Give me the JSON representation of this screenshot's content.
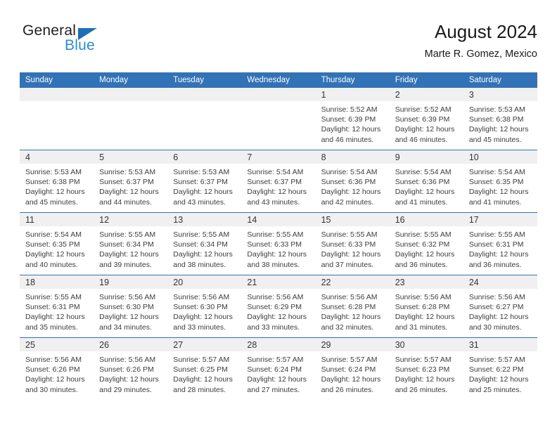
{
  "brand": {
    "name_part1": "General",
    "name_part2": "Blue"
  },
  "header": {
    "title": "August 2024",
    "subtitle": "Marte R. Gomez, Mexico"
  },
  "colors": {
    "header_blue": "#3272b6",
    "brand_blue": "#2b8ccc",
    "logo_triangle": "#1f6fb5",
    "daynum_band": "#f0f0f0",
    "text": "#1a1a1a"
  },
  "weekdays": [
    "Sunday",
    "Monday",
    "Tuesday",
    "Wednesday",
    "Thursday",
    "Friday",
    "Saturday"
  ],
  "weeks": [
    [
      {
        "day": "",
        "sunrise": "",
        "sunset": "",
        "daylight1": "",
        "daylight2": ""
      },
      {
        "day": "",
        "sunrise": "",
        "sunset": "",
        "daylight1": "",
        "daylight2": ""
      },
      {
        "day": "",
        "sunrise": "",
        "sunset": "",
        "daylight1": "",
        "daylight2": ""
      },
      {
        "day": "",
        "sunrise": "",
        "sunset": "",
        "daylight1": "",
        "daylight2": ""
      },
      {
        "day": "1",
        "sunrise": "Sunrise: 5:52 AM",
        "sunset": "Sunset: 6:39 PM",
        "daylight1": "Daylight: 12 hours",
        "daylight2": "and 46 minutes."
      },
      {
        "day": "2",
        "sunrise": "Sunrise: 5:52 AM",
        "sunset": "Sunset: 6:39 PM",
        "daylight1": "Daylight: 12 hours",
        "daylight2": "and 46 minutes."
      },
      {
        "day": "3",
        "sunrise": "Sunrise: 5:53 AM",
        "sunset": "Sunset: 6:38 PM",
        "daylight1": "Daylight: 12 hours",
        "daylight2": "and 45 minutes."
      }
    ],
    [
      {
        "day": "4",
        "sunrise": "Sunrise: 5:53 AM",
        "sunset": "Sunset: 6:38 PM",
        "daylight1": "Daylight: 12 hours",
        "daylight2": "and 45 minutes."
      },
      {
        "day": "5",
        "sunrise": "Sunrise: 5:53 AM",
        "sunset": "Sunset: 6:37 PM",
        "daylight1": "Daylight: 12 hours",
        "daylight2": "and 44 minutes."
      },
      {
        "day": "6",
        "sunrise": "Sunrise: 5:53 AM",
        "sunset": "Sunset: 6:37 PM",
        "daylight1": "Daylight: 12 hours",
        "daylight2": "and 43 minutes."
      },
      {
        "day": "7",
        "sunrise": "Sunrise: 5:54 AM",
        "sunset": "Sunset: 6:37 PM",
        "daylight1": "Daylight: 12 hours",
        "daylight2": "and 43 minutes."
      },
      {
        "day": "8",
        "sunrise": "Sunrise: 5:54 AM",
        "sunset": "Sunset: 6:36 PM",
        "daylight1": "Daylight: 12 hours",
        "daylight2": "and 42 minutes."
      },
      {
        "day": "9",
        "sunrise": "Sunrise: 5:54 AM",
        "sunset": "Sunset: 6:36 PM",
        "daylight1": "Daylight: 12 hours",
        "daylight2": "and 41 minutes."
      },
      {
        "day": "10",
        "sunrise": "Sunrise: 5:54 AM",
        "sunset": "Sunset: 6:35 PM",
        "daylight1": "Daylight: 12 hours",
        "daylight2": "and 41 minutes."
      }
    ],
    [
      {
        "day": "11",
        "sunrise": "Sunrise: 5:54 AM",
        "sunset": "Sunset: 6:35 PM",
        "daylight1": "Daylight: 12 hours",
        "daylight2": "and 40 minutes."
      },
      {
        "day": "12",
        "sunrise": "Sunrise: 5:55 AM",
        "sunset": "Sunset: 6:34 PM",
        "daylight1": "Daylight: 12 hours",
        "daylight2": "and 39 minutes."
      },
      {
        "day": "13",
        "sunrise": "Sunrise: 5:55 AM",
        "sunset": "Sunset: 6:34 PM",
        "daylight1": "Daylight: 12 hours",
        "daylight2": "and 38 minutes."
      },
      {
        "day": "14",
        "sunrise": "Sunrise: 5:55 AM",
        "sunset": "Sunset: 6:33 PM",
        "daylight1": "Daylight: 12 hours",
        "daylight2": "and 38 minutes."
      },
      {
        "day": "15",
        "sunrise": "Sunrise: 5:55 AM",
        "sunset": "Sunset: 6:33 PM",
        "daylight1": "Daylight: 12 hours",
        "daylight2": "and 37 minutes."
      },
      {
        "day": "16",
        "sunrise": "Sunrise: 5:55 AM",
        "sunset": "Sunset: 6:32 PM",
        "daylight1": "Daylight: 12 hours",
        "daylight2": "and 36 minutes."
      },
      {
        "day": "17",
        "sunrise": "Sunrise: 5:55 AM",
        "sunset": "Sunset: 6:31 PM",
        "daylight1": "Daylight: 12 hours",
        "daylight2": "and 36 minutes."
      }
    ],
    [
      {
        "day": "18",
        "sunrise": "Sunrise: 5:55 AM",
        "sunset": "Sunset: 6:31 PM",
        "daylight1": "Daylight: 12 hours",
        "daylight2": "and 35 minutes."
      },
      {
        "day": "19",
        "sunrise": "Sunrise: 5:56 AM",
        "sunset": "Sunset: 6:30 PM",
        "daylight1": "Daylight: 12 hours",
        "daylight2": "and 34 minutes."
      },
      {
        "day": "20",
        "sunrise": "Sunrise: 5:56 AM",
        "sunset": "Sunset: 6:30 PM",
        "daylight1": "Daylight: 12 hours",
        "daylight2": "and 33 minutes."
      },
      {
        "day": "21",
        "sunrise": "Sunrise: 5:56 AM",
        "sunset": "Sunset: 6:29 PM",
        "daylight1": "Daylight: 12 hours",
        "daylight2": "and 33 minutes."
      },
      {
        "day": "22",
        "sunrise": "Sunrise: 5:56 AM",
        "sunset": "Sunset: 6:28 PM",
        "daylight1": "Daylight: 12 hours",
        "daylight2": "and 32 minutes."
      },
      {
        "day": "23",
        "sunrise": "Sunrise: 5:56 AM",
        "sunset": "Sunset: 6:28 PM",
        "daylight1": "Daylight: 12 hours",
        "daylight2": "and 31 minutes."
      },
      {
        "day": "24",
        "sunrise": "Sunrise: 5:56 AM",
        "sunset": "Sunset: 6:27 PM",
        "daylight1": "Daylight: 12 hours",
        "daylight2": "and 30 minutes."
      }
    ],
    [
      {
        "day": "25",
        "sunrise": "Sunrise: 5:56 AM",
        "sunset": "Sunset: 6:26 PM",
        "daylight1": "Daylight: 12 hours",
        "daylight2": "and 30 minutes."
      },
      {
        "day": "26",
        "sunrise": "Sunrise: 5:56 AM",
        "sunset": "Sunset: 6:26 PM",
        "daylight1": "Daylight: 12 hours",
        "daylight2": "and 29 minutes."
      },
      {
        "day": "27",
        "sunrise": "Sunrise: 5:57 AM",
        "sunset": "Sunset: 6:25 PM",
        "daylight1": "Daylight: 12 hours",
        "daylight2": "and 28 minutes."
      },
      {
        "day": "28",
        "sunrise": "Sunrise: 5:57 AM",
        "sunset": "Sunset: 6:24 PM",
        "daylight1": "Daylight: 12 hours",
        "daylight2": "and 27 minutes."
      },
      {
        "day": "29",
        "sunrise": "Sunrise: 5:57 AM",
        "sunset": "Sunset: 6:24 PM",
        "daylight1": "Daylight: 12 hours",
        "daylight2": "and 26 minutes."
      },
      {
        "day": "30",
        "sunrise": "Sunrise: 5:57 AM",
        "sunset": "Sunset: 6:23 PM",
        "daylight1": "Daylight: 12 hours",
        "daylight2": "and 26 minutes."
      },
      {
        "day": "31",
        "sunrise": "Sunrise: 5:57 AM",
        "sunset": "Sunset: 6:22 PM",
        "daylight1": "Daylight: 12 hours",
        "daylight2": "and 25 minutes."
      }
    ]
  ]
}
